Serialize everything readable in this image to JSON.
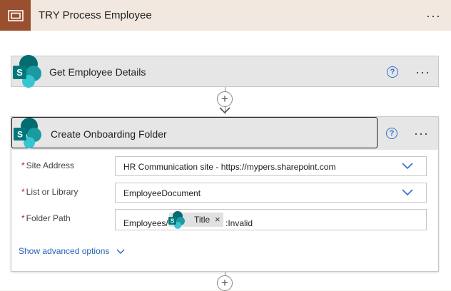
{
  "scope": {
    "title": "TRY Process Employee",
    "icon": "scope-icon",
    "accent_color": "#9a4f2e"
  },
  "actions": {
    "get_employee": {
      "title": "Get Employee Details",
      "icon": "sharepoint-icon"
    },
    "create_folder": {
      "title": "Create Onboarding Folder",
      "icon": "sharepoint-icon",
      "fields": {
        "site_address": {
          "label": "Site Address",
          "required": "*",
          "value": "HR Communication site - https://mypers.sharepoint.com"
        },
        "list_library": {
          "label": "List or Library",
          "required": "*",
          "value": "EmployeeDocument"
        },
        "folder_path": {
          "label": "Folder Path",
          "required": "*",
          "prefix": "Employees/",
          "token_label": "Title",
          "token_remove": "×",
          "suffix": ":Invalid"
        }
      },
      "advanced_link": "Show advanced options"
    }
  },
  "menu_glyph": "···",
  "help_glyph": "?",
  "add_glyph": "+",
  "colors": {
    "sharepoint_teal": "#0b828c",
    "link_blue": "#2563b8",
    "required_red": "#a4262c"
  }
}
